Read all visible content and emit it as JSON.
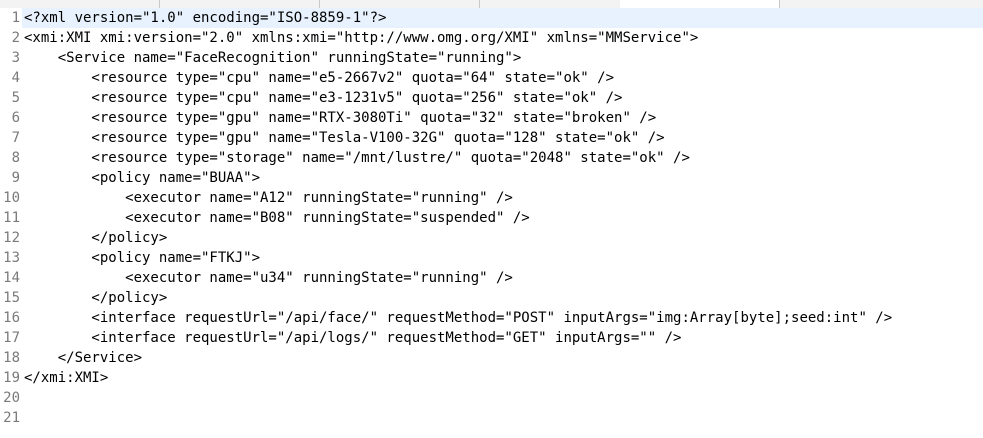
{
  "tabs": [
    "",
    "",
    "",
    ""
  ],
  "lines": [
    "<?xml version=\"1.0\" encoding=\"ISO-8859-1\"?>",
    "<xmi:XMI xmi:version=\"2.0\" xmlns:xmi=\"http://www.omg.org/XMI\" xmlns=\"MMService\">",
    "    <Service name=\"FaceRecognition\" runningState=\"running\">",
    "        <resource type=\"cpu\" name=\"e5-2667v2\" quota=\"64\" state=\"ok\" />",
    "        <resource type=\"cpu\" name=\"e3-1231v5\" quota=\"256\" state=\"ok\" />",
    "        <resource type=\"gpu\" name=\"RTX-3080Ti\" quota=\"32\" state=\"broken\" />",
    "        <resource type=\"gpu\" name=\"Tesla-V100-32G\" quota=\"128\" state=\"ok\" />",
    "        <resource type=\"storage\" name=\"/mnt/lustre/\" quota=\"2048\" state=\"ok\" />",
    "        <policy name=\"BUAA\">",
    "            <executor name=\"A12\" runningState=\"running\" />",
    "            <executor name=\"B08\" runningState=\"suspended\" />",
    "        </policy>",
    "        <policy name=\"FTKJ\">",
    "            <executor name=\"u34\" runningState=\"running\" />",
    "        </policy>",
    "        <interface requestUrl=\"/api/face/\" requestMethod=\"POST\" inputArgs=\"img:Array[byte];seed:int\" />",
    "        <interface requestUrl=\"/api/logs/\" requestMethod=\"GET\" inputArgs=\"\" />",
    "    </Service>",
    "</xmi:XMI>",
    "",
    ""
  ],
  "line_numbers": [
    "1",
    "2",
    "3",
    "4",
    "5",
    "6",
    "7",
    "8",
    "9",
    "10",
    "11",
    "12",
    "13",
    "14",
    "15",
    "16",
    "17",
    "18",
    "19",
    "20",
    "21"
  ]
}
